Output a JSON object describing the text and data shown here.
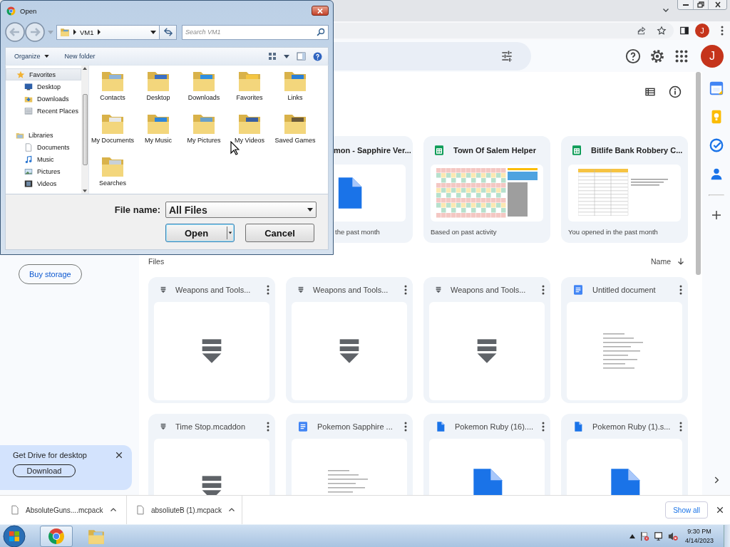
{
  "dialog": {
    "title": "Open",
    "address": {
      "segments": [
        "VM1"
      ]
    },
    "search": {
      "placeholder": "Search VM1"
    },
    "toolbar": [
      {
        "label": "Organize",
        "kind": "menu"
      },
      {
        "label": "New folder",
        "kind": "plain"
      }
    ],
    "nav_pane": [
      {
        "label": "Favorites",
        "selected": true,
        "children": [
          {
            "label": "Desktop",
            "selected": false
          },
          {
            "label": "Downloads",
            "selected": false
          },
          {
            "label": "Recent Places",
            "selected": false
          }
        ]
      },
      {
        "label": "Libraries",
        "selected": false,
        "children": [
          {
            "label": "Documents",
            "selected": false
          },
          {
            "label": "Music",
            "selected": false
          },
          {
            "label": "Pictures",
            "selected": false
          },
          {
            "label": "Videos",
            "selected": false
          }
        ]
      }
    ],
    "folders": [
      "Contacts",
      "Desktop",
      "Downloads",
      "Favorites",
      "Links",
      "My Documents",
      "My Music",
      "My Pictures",
      "My Videos",
      "Saved Games",
      "Searches"
    ],
    "file_name": {
      "label": "File name:",
      "value": "All Files"
    },
    "buttons": [
      {
        "label": "Open",
        "kind": "split",
        "default": true
      },
      {
        "label": "Cancel",
        "kind": "plain",
        "default": false
      }
    ]
  },
  "browser": {
    "profile_avatar": "J"
  },
  "drive": {
    "account_avatar": "J",
    "sidebar": {
      "buy_storage": "Buy storage",
      "promo": {
        "title": "Get Drive for desktop",
        "button": "Download"
      }
    },
    "suggested": [
      {
        "title": "mon - Sapphire Ver...",
        "kind": "clipped",
        "reason": "the past month"
      },
      {
        "title": "Town Of Salem Helper",
        "kind": "sheet",
        "reason": "Based on past activity"
      },
      {
        "title": "Bitlife Bank Robbery C...",
        "kind": "table",
        "reason": "You opened in the past month"
      }
    ],
    "files_heading": "Files",
    "sort": "Name",
    "files": [
      {
        "title": "Weapons and Tools...",
        "kind": "addon"
      },
      {
        "title": "Weapons and Tools...",
        "kind": "addon"
      },
      {
        "title": "Weapons and Tools...",
        "kind": "addon"
      },
      {
        "title": "Untitled document",
        "kind": "doc"
      },
      {
        "title": "Time Stop.mcaddon",
        "kind": "addon"
      },
      {
        "title": "Pokemon Sapphire ...",
        "kind": "doc"
      },
      {
        "title": "Pokemon Ruby (16)....",
        "kind": "file"
      },
      {
        "title": "Pokemon Ruby (1).s...",
        "kind": "file"
      }
    ]
  },
  "downloads": {
    "items": [
      "AbsoluteGuns....mcpack",
      "absoliuteB (1).mcpack"
    ],
    "show_all": "Show all"
  },
  "taskbar": {
    "apps": [
      {
        "kind": "browser",
        "selected": true
      },
      {
        "kind": "explorer",
        "selected": false
      }
    ],
    "time": "9:30 PM",
    "date": "4/14/2023"
  }
}
